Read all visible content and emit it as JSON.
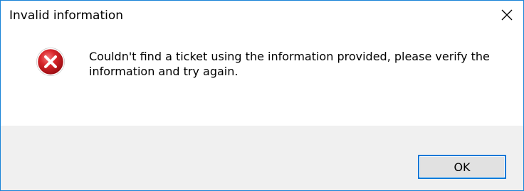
{
  "window": {
    "title": "Invalid information",
    "close_icon": "close-icon"
  },
  "body": {
    "icon": "error-icon",
    "message": "Couldn't find a ticket using the information provided, please verify the information and try again."
  },
  "buttons": {
    "ok_label": "OK"
  },
  "colors": {
    "window_border": "#1883d7",
    "footer_background": "#f0f0f0",
    "button_focus": "#0078d7",
    "error_red": "#c4161c"
  }
}
